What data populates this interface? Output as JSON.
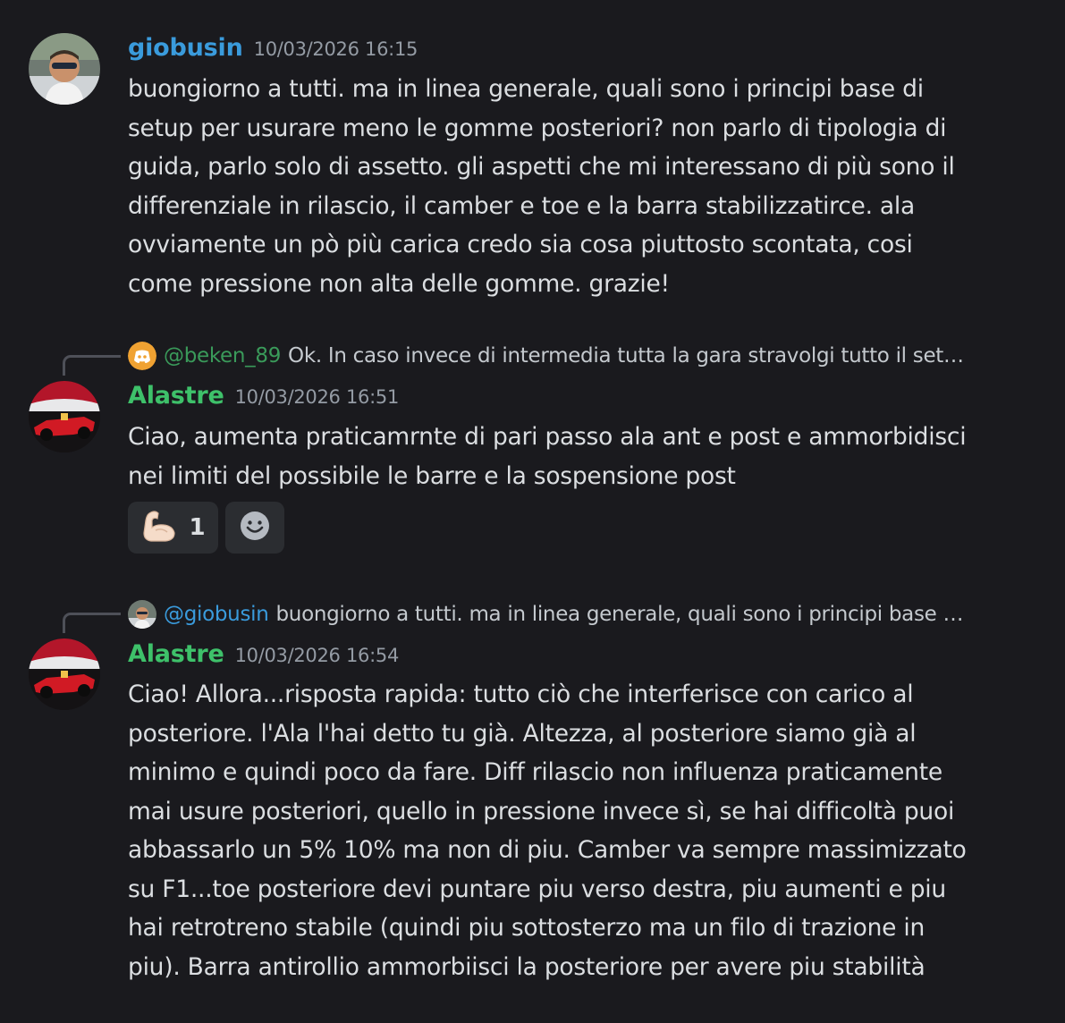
{
  "colors": {
    "background": "#1a1a1e",
    "giobusin_name": "#3a9bdc",
    "alastre_name": "#3ec16a",
    "beken_name": "#3a9a5a",
    "timestamp": "#949ba4"
  },
  "messages": [
    {
      "username": "giobusin",
      "timestamp": "10/03/2026 16:15",
      "lines": [
        "buongiorno a tutti. ma in linea generale, quali sono i principi base di",
        "setup per usurare meno le gomme posteriori? non parlo di tipologia di",
        "guida, parlo solo di assetto.  gli aspetti che mi interessano di più sono il",
        "differenziale in rilascio, il camber e toe e la barra stabilizzatirce. ala",
        "ovviamente un pò più carica credo sia cosa piuttosto scontata, cosi",
        "come pressione non alta delle gomme. grazie!"
      ]
    },
    {
      "reply_icon": "discord-logo-icon",
      "reply_user": "@beken_89",
      "reply_text": "Ok. In caso invece di intermedia tutta la gara stravolgi tutto il set…",
      "username": "Alastre",
      "timestamp": "10/03/2026 16:51",
      "lines": [
        "Ciao, aumenta praticamrnte di pari passo ala ant e post e ammorbidisci",
        "nei limiti del possibile le barre e la sospensione post"
      ],
      "reactions": [
        {
          "emoji": "flexed-biceps-icon",
          "count": "1"
        },
        {
          "emoji": "add-reaction-icon"
        }
      ]
    },
    {
      "reply_user": "@giobusin",
      "reply_text": "buongiorno a tutti. ma in linea generale, quali sono i principi base …",
      "username": "Alastre",
      "timestamp": "10/03/2026 16:54",
      "lines": [
        "Ciao! Allora...risposta rapida: tutto ciò che interferisce con carico al",
        "posteriore. l'Ala l'hai detto tu già. Altezza, al posteriore siamo già al",
        "minimo e quindi poco da fare. Diff rilascio non influenza praticamente",
        "mai usure posteriori, quello in pressione invece sì, se hai difficoltà puoi",
        "abbassarlo un 5% 10% ma non di piu. Camber va sempre massimizzato",
        "su F1...toe posteriore devi puntare piu verso destra, piu aumenti e piu",
        "hai retrotreno stabile (quindi piu sottosterzo ma un filo di trazione in",
        "piu). Barra antirollio ammorbiisci la posteriore per avere piu stabilità"
      ]
    }
  ]
}
